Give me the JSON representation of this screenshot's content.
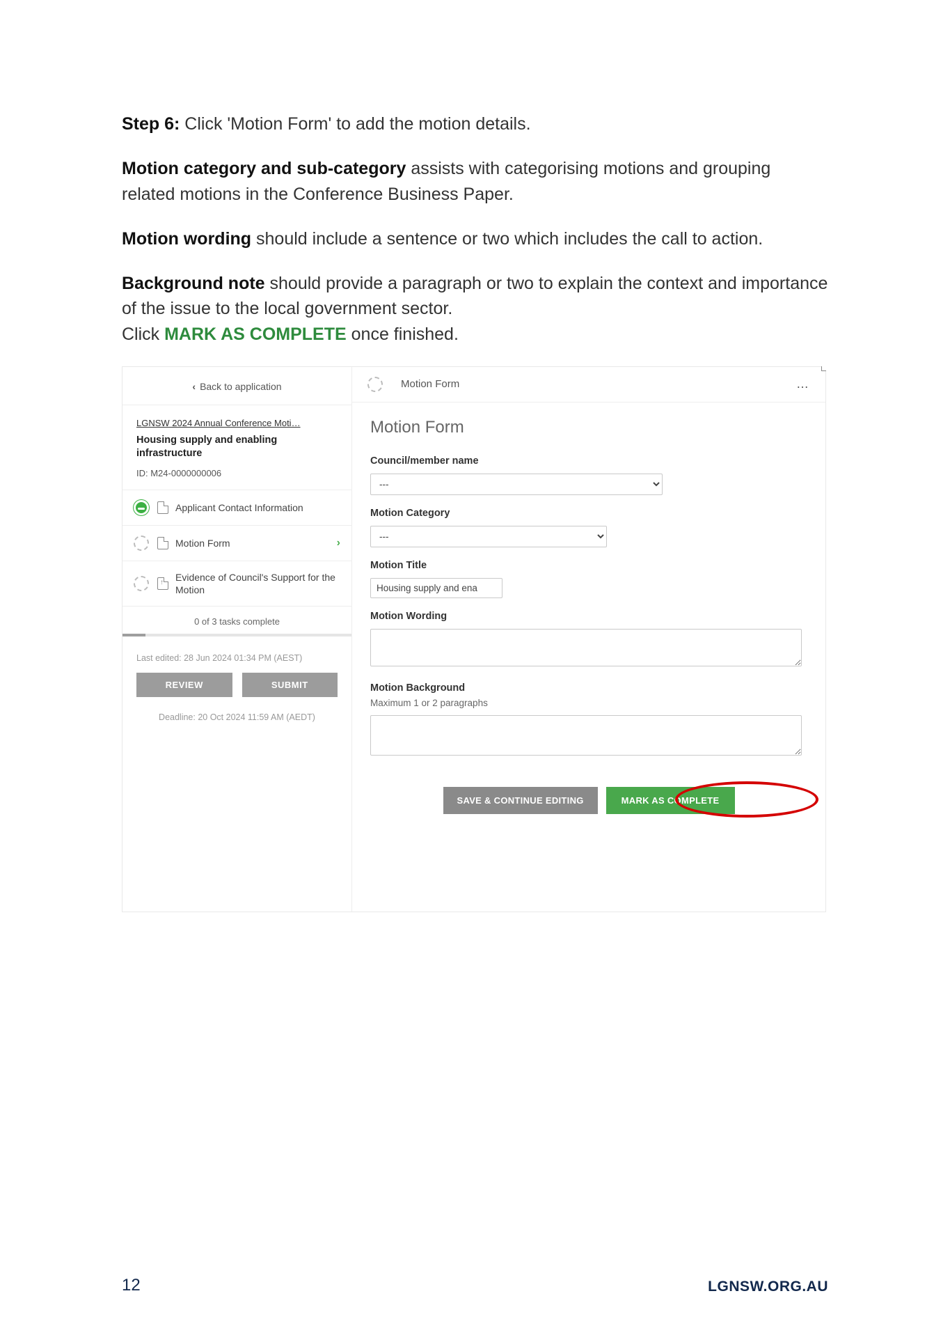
{
  "instructions": {
    "step6_label": "Step 6:",
    "step6_text": " Click 'Motion Form' to add the motion details.",
    "cat_label": "Motion category and sub-category",
    "cat_text": " assists with categorising motions and grouping related motions in the Conference Business Paper.",
    "wording_label": "Motion wording",
    "wording_text": " should include a sentence or two which includes the call to action.",
    "bg_label": "Background note",
    "bg_text": " should provide a paragraph or two to explain the context and importance of the issue to the local government sector.",
    "click_prefix": "Click ",
    "mark_complete": "MARK AS COMPLETE",
    "click_suffix": " once finished."
  },
  "sidebar": {
    "back_label": "Back to application",
    "conference_link": "LGNSW 2024 Annual Conference Moti…",
    "application_title": "Housing supply and enabling infrastructure",
    "application_id": "ID: M24-0000000006",
    "tasks": [
      {
        "label": "Applicant Contact Information"
      },
      {
        "label": "Motion Form"
      },
      {
        "label": "Evidence of Council's Support for the Motion"
      }
    ],
    "tasks_complete": "0 of 3 tasks complete",
    "last_edited": "Last edited: 28 Jun 2024 01:34 PM (AEST)",
    "review_btn": "REVIEW",
    "submit_btn": "SUBMIT",
    "deadline": "Deadline: 20 Oct 2024 11:59 AM (AEDT)"
  },
  "form": {
    "header_title": "Motion Form",
    "title": "Motion Form",
    "labels": {
      "council": "Council/member name",
      "category": "Motion Category",
      "motion_title": "Motion Title",
      "wording": "Motion Wording",
      "background": "Motion Background"
    },
    "help": {
      "background": "Maximum 1 or 2 paragraphs"
    },
    "values": {
      "council_selected": "---",
      "category_selected": "---",
      "motion_title_value": "Housing supply and ena"
    },
    "buttons": {
      "save": "SAVE & CONTINUE EDITING",
      "complete": "MARK AS COMPLETE"
    }
  },
  "footer": {
    "page": "12",
    "site": "LGNSW.ORG.AU"
  }
}
